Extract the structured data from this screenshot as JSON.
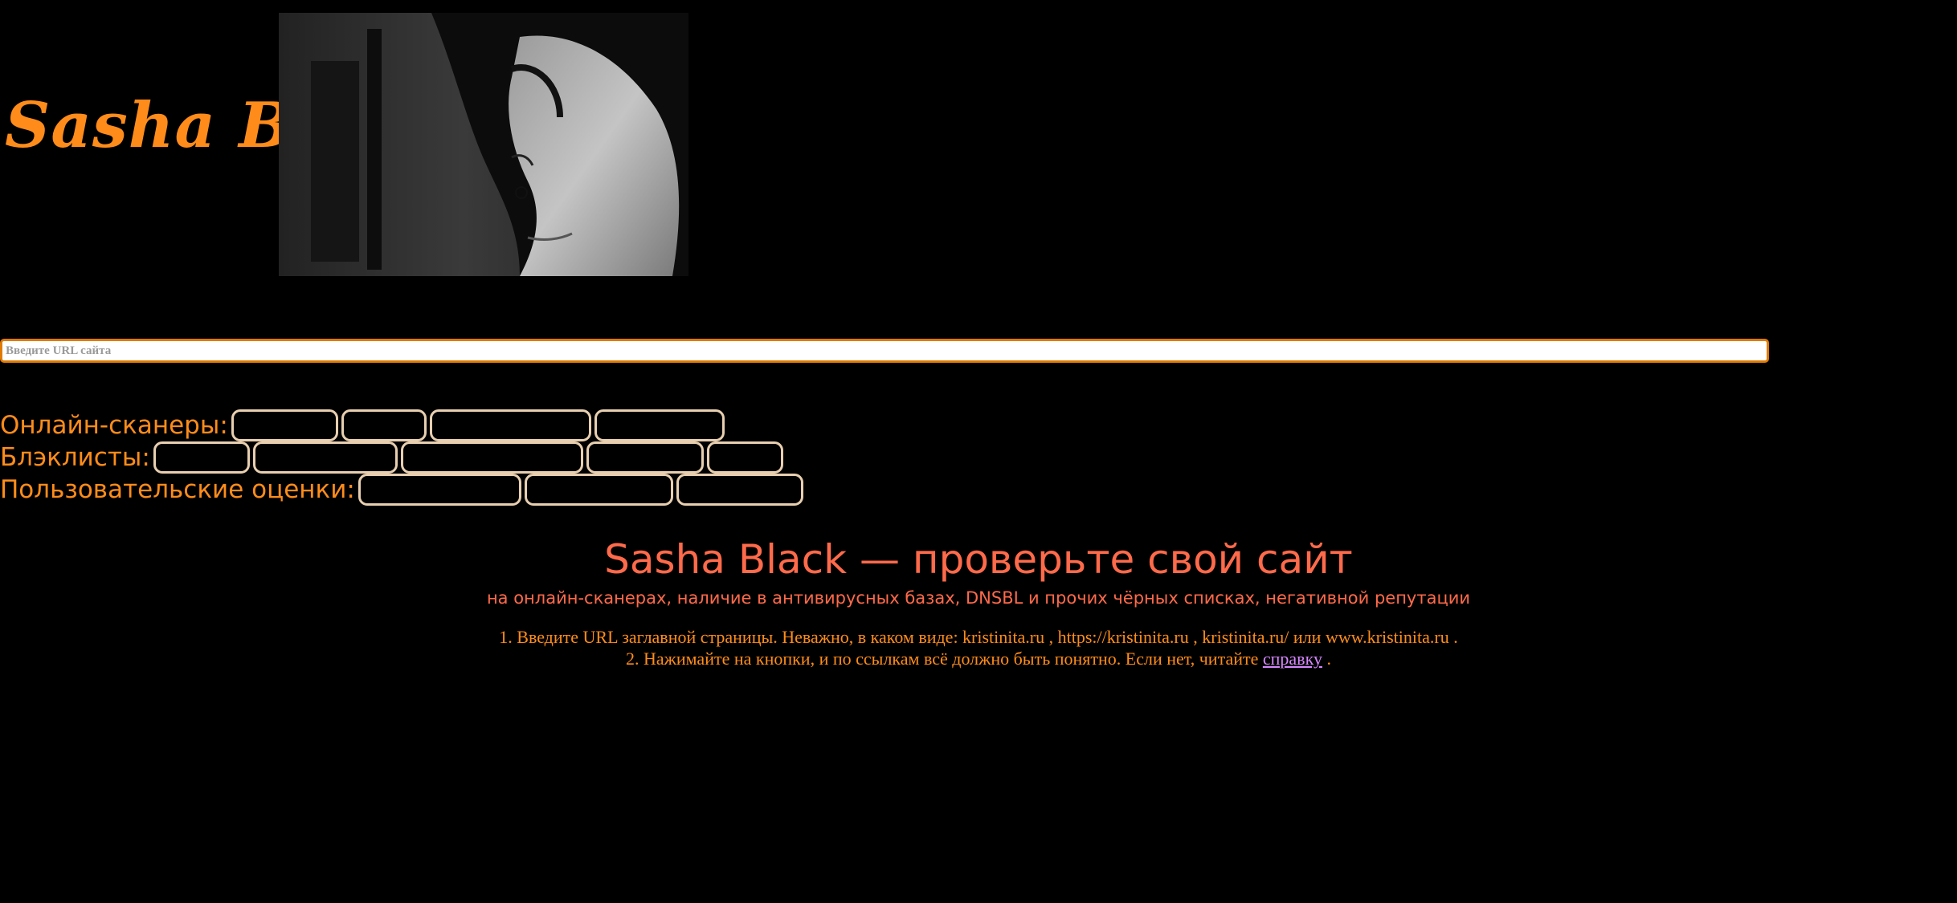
{
  "header": {
    "logo_text": "Sasha Black",
    "photo_icon": "portrait-photo"
  },
  "search": {
    "placeholder": "Введите URL сайта",
    "value": ""
  },
  "rows": {
    "scanners": {
      "label": "Онлайн-сканеры:",
      "buttons": [
        "",
        "",
        "",
        ""
      ]
    },
    "blacklists": {
      "label": "Блэклисты:",
      "buttons": [
        "",
        "",
        "",
        "",
        ""
      ]
    },
    "ratings": {
      "label": "Пользовательские оценки:",
      "buttons": [
        "",
        "",
        ""
      ]
    }
  },
  "main": {
    "title": "Sasha Black — проверьте свой сайт",
    "subtitle": "на онлайн-сканерах, наличие в антивирусных базах, DNSBL и прочих чёрных списках, негативной репутации",
    "instruction1": "1. Введите URL заглавной страницы. Неважно, в каком виде: kristinita.ru , https://kristinita.ru , kristinita.ru/ или www.kristinita.ru .",
    "instruction2_before": "2. Нажимайте на кнопки, и по ссылкам всё должно быть понятно. Если нет, читайте",
    "instruction2_link": "справку",
    "instruction2_after": " ."
  },
  "colors": {
    "background": "#000000",
    "accent_orange": "#ff8c1a",
    "title_coral": "#ff6a4a",
    "link_violet": "#d787ff",
    "pill_border": "#e8cfb0",
    "input_border": "#e07a00"
  }
}
